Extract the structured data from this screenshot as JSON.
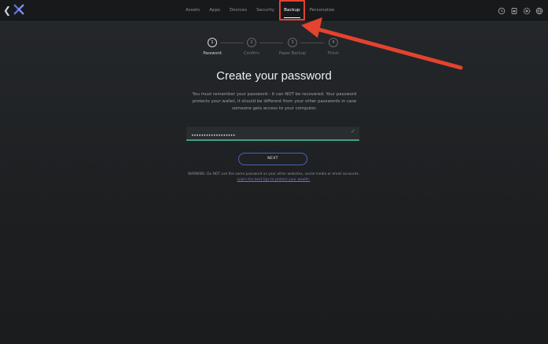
{
  "topbar": {
    "back_icon": "chevron-left-icon",
    "logo_icon": "app-logo-icon",
    "tabs": [
      {
        "label": "Assets"
      },
      {
        "label": "Apps"
      },
      {
        "label": "Devices"
      },
      {
        "label": "Security"
      },
      {
        "label": "Backup"
      },
      {
        "label": "Personalize"
      }
    ],
    "active_tab": "Backup",
    "right_icons": [
      "history-icon",
      "lock-icon",
      "settings-icon",
      "globe-icon"
    ]
  },
  "stepper": {
    "steps": [
      {
        "number": "1",
        "label": "Password"
      },
      {
        "number": "2",
        "label": "Confirm"
      },
      {
        "number": "3",
        "label": "Paper Backup"
      },
      {
        "number": "4",
        "label": "Finish"
      }
    ],
    "current": 1
  },
  "main": {
    "title": "Create your password",
    "description": "You must remember your password - it can NOT be recovered. Your password protects your wallet, it should be different from your other passwords in case someone gets access to your computer.",
    "password_value": "••••••••••••••••••",
    "next_label": "NEXT",
    "warning_text": "WARNING: Do NOT use the same password as your other websites, social media or email accounts.",
    "warning_link": "Learn the best tips to protect your wealth."
  },
  "annotation": {
    "highlight_color": "#e4432f"
  }
}
